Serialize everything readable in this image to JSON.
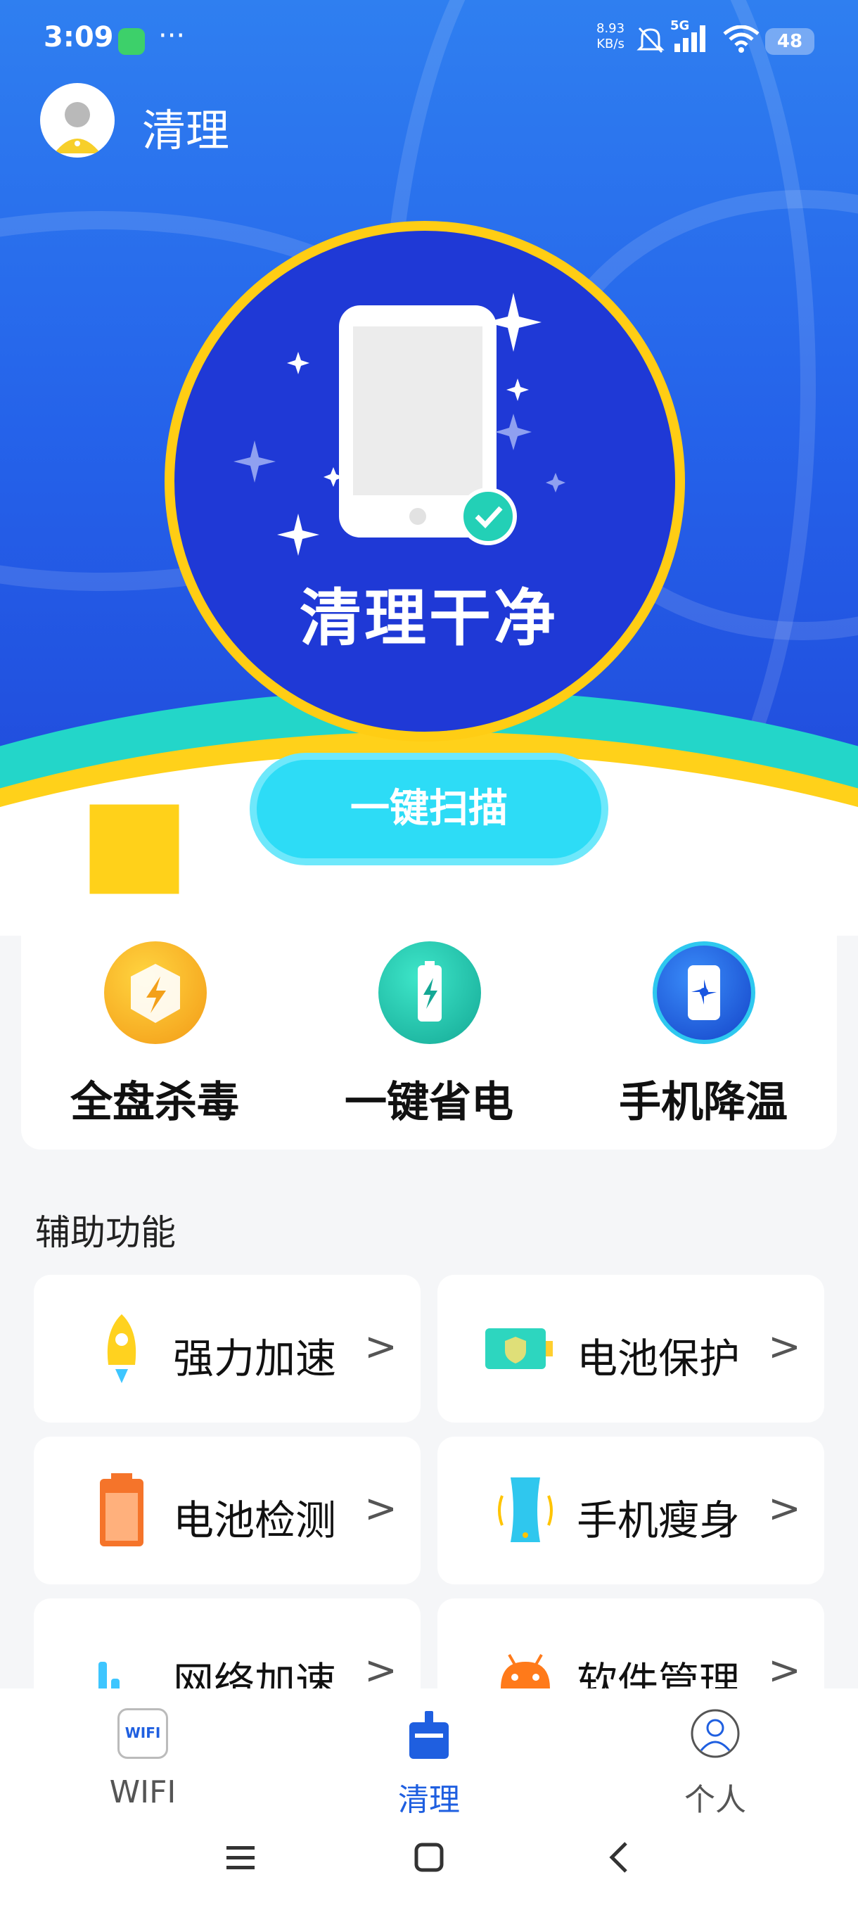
{
  "status_bar": {
    "time": "3:09",
    "more": "···",
    "net_speed": "8.93",
    "net_unit": "KB/s",
    "network": "5G",
    "battery": "48"
  },
  "header": {
    "title": "清理"
  },
  "hero": {
    "status_text": "清理干净",
    "scan_button": "一键扫描"
  },
  "quick_actions": [
    {
      "label": "全盘杀毒",
      "icon": "shield-bolt-icon"
    },
    {
      "label": "一键省电",
      "icon": "battery-bolt-icon"
    },
    {
      "label": "手机降温",
      "icon": "phone-fan-icon"
    }
  ],
  "section": {
    "title": "辅助功能"
  },
  "features": [
    {
      "label": "强力加速",
      "icon": "rocket-icon"
    },
    {
      "label": "电池保护",
      "icon": "battery-shield-icon"
    },
    {
      "label": "电池检测",
      "icon": "battery-icon"
    },
    {
      "label": "手机瘦身",
      "icon": "phone-slim-icon"
    },
    {
      "label": "网络加速",
      "icon": "signal-bars-icon"
    },
    {
      "label": "软件管理",
      "icon": "android-icon"
    }
  ],
  "chevron": ">",
  "tabs": [
    {
      "label": "WIFI",
      "badge": "WIFI",
      "active": false
    },
    {
      "label": "清理",
      "active": true
    },
    {
      "label": "个人",
      "active": false
    }
  ],
  "colors": {
    "accent": "#1f5fe0",
    "ring": "#ffcd14",
    "scan": "#2ddcf6"
  }
}
